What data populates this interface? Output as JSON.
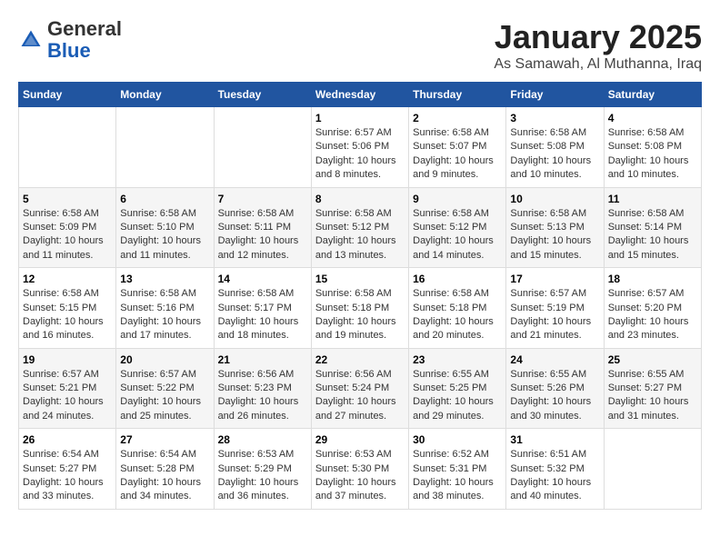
{
  "header": {
    "logo_general": "General",
    "logo_blue": "Blue",
    "month": "January 2025",
    "location": "As Samawah, Al Muthanna, Iraq"
  },
  "days_of_week": [
    "Sunday",
    "Monday",
    "Tuesday",
    "Wednesday",
    "Thursday",
    "Friday",
    "Saturday"
  ],
  "weeks": [
    [
      {
        "day": "",
        "info": ""
      },
      {
        "day": "",
        "info": ""
      },
      {
        "day": "",
        "info": ""
      },
      {
        "day": "1",
        "info": "Sunrise: 6:57 AM\nSunset: 5:06 PM\nDaylight: 10 hours\nand 8 minutes."
      },
      {
        "day": "2",
        "info": "Sunrise: 6:58 AM\nSunset: 5:07 PM\nDaylight: 10 hours\nand 9 minutes."
      },
      {
        "day": "3",
        "info": "Sunrise: 6:58 AM\nSunset: 5:08 PM\nDaylight: 10 hours\nand 10 minutes."
      },
      {
        "day": "4",
        "info": "Sunrise: 6:58 AM\nSunset: 5:08 PM\nDaylight: 10 hours\nand 10 minutes."
      }
    ],
    [
      {
        "day": "5",
        "info": "Sunrise: 6:58 AM\nSunset: 5:09 PM\nDaylight: 10 hours\nand 11 minutes."
      },
      {
        "day": "6",
        "info": "Sunrise: 6:58 AM\nSunset: 5:10 PM\nDaylight: 10 hours\nand 11 minutes."
      },
      {
        "day": "7",
        "info": "Sunrise: 6:58 AM\nSunset: 5:11 PM\nDaylight: 10 hours\nand 12 minutes."
      },
      {
        "day": "8",
        "info": "Sunrise: 6:58 AM\nSunset: 5:12 PM\nDaylight: 10 hours\nand 13 minutes."
      },
      {
        "day": "9",
        "info": "Sunrise: 6:58 AM\nSunset: 5:12 PM\nDaylight: 10 hours\nand 14 minutes."
      },
      {
        "day": "10",
        "info": "Sunrise: 6:58 AM\nSunset: 5:13 PM\nDaylight: 10 hours\nand 15 minutes."
      },
      {
        "day": "11",
        "info": "Sunrise: 6:58 AM\nSunset: 5:14 PM\nDaylight: 10 hours\nand 15 minutes."
      }
    ],
    [
      {
        "day": "12",
        "info": "Sunrise: 6:58 AM\nSunset: 5:15 PM\nDaylight: 10 hours\nand 16 minutes."
      },
      {
        "day": "13",
        "info": "Sunrise: 6:58 AM\nSunset: 5:16 PM\nDaylight: 10 hours\nand 17 minutes."
      },
      {
        "day": "14",
        "info": "Sunrise: 6:58 AM\nSunset: 5:17 PM\nDaylight: 10 hours\nand 18 minutes."
      },
      {
        "day": "15",
        "info": "Sunrise: 6:58 AM\nSunset: 5:18 PM\nDaylight: 10 hours\nand 19 minutes."
      },
      {
        "day": "16",
        "info": "Sunrise: 6:58 AM\nSunset: 5:18 PM\nDaylight: 10 hours\nand 20 minutes."
      },
      {
        "day": "17",
        "info": "Sunrise: 6:57 AM\nSunset: 5:19 PM\nDaylight: 10 hours\nand 21 minutes."
      },
      {
        "day": "18",
        "info": "Sunrise: 6:57 AM\nSunset: 5:20 PM\nDaylight: 10 hours\nand 23 minutes."
      }
    ],
    [
      {
        "day": "19",
        "info": "Sunrise: 6:57 AM\nSunset: 5:21 PM\nDaylight: 10 hours\nand 24 minutes."
      },
      {
        "day": "20",
        "info": "Sunrise: 6:57 AM\nSunset: 5:22 PM\nDaylight: 10 hours\nand 25 minutes."
      },
      {
        "day": "21",
        "info": "Sunrise: 6:56 AM\nSunset: 5:23 PM\nDaylight: 10 hours\nand 26 minutes."
      },
      {
        "day": "22",
        "info": "Sunrise: 6:56 AM\nSunset: 5:24 PM\nDaylight: 10 hours\nand 27 minutes."
      },
      {
        "day": "23",
        "info": "Sunrise: 6:55 AM\nSunset: 5:25 PM\nDaylight: 10 hours\nand 29 minutes."
      },
      {
        "day": "24",
        "info": "Sunrise: 6:55 AM\nSunset: 5:26 PM\nDaylight: 10 hours\nand 30 minutes."
      },
      {
        "day": "25",
        "info": "Sunrise: 6:55 AM\nSunset: 5:27 PM\nDaylight: 10 hours\nand 31 minutes."
      }
    ],
    [
      {
        "day": "26",
        "info": "Sunrise: 6:54 AM\nSunset: 5:27 PM\nDaylight: 10 hours\nand 33 minutes."
      },
      {
        "day": "27",
        "info": "Sunrise: 6:54 AM\nSunset: 5:28 PM\nDaylight: 10 hours\nand 34 minutes."
      },
      {
        "day": "28",
        "info": "Sunrise: 6:53 AM\nSunset: 5:29 PM\nDaylight: 10 hours\nand 36 minutes."
      },
      {
        "day": "29",
        "info": "Sunrise: 6:53 AM\nSunset: 5:30 PM\nDaylight: 10 hours\nand 37 minutes."
      },
      {
        "day": "30",
        "info": "Sunrise: 6:52 AM\nSunset: 5:31 PM\nDaylight: 10 hours\nand 38 minutes."
      },
      {
        "day": "31",
        "info": "Sunrise: 6:51 AM\nSunset: 5:32 PM\nDaylight: 10 hours\nand 40 minutes."
      },
      {
        "day": "",
        "info": ""
      }
    ]
  ]
}
